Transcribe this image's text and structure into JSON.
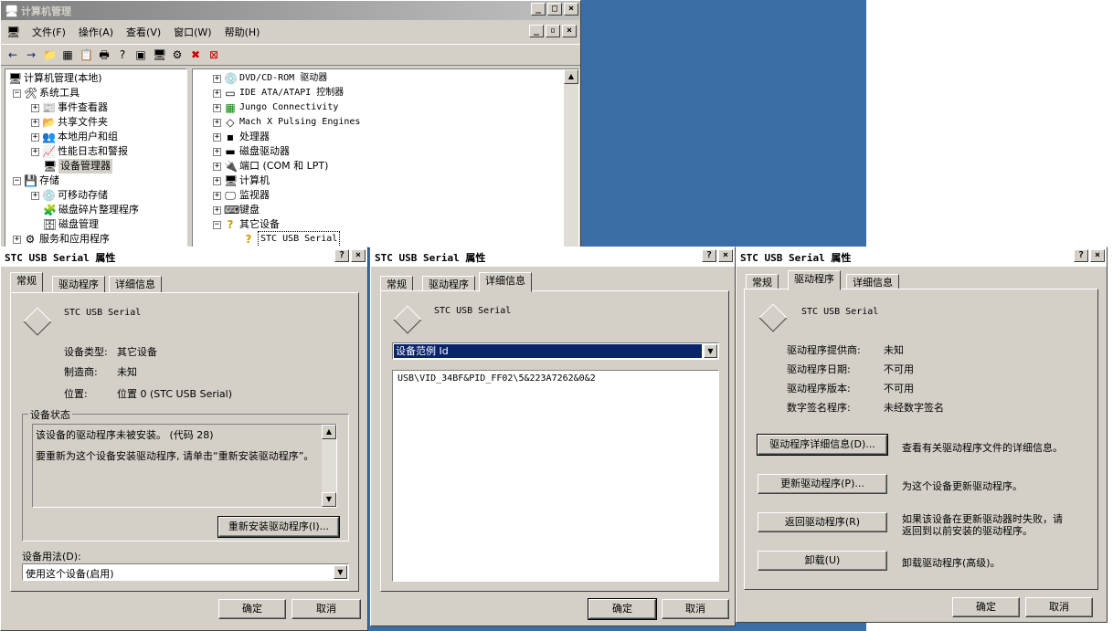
{
  "mmc": {
    "title": "计算机管理",
    "menu": [
      "文件(F)",
      "操作(A)",
      "查看(V)",
      "窗口(W)",
      "帮助(H)"
    ],
    "tree": {
      "root": "计算机管理(本地)",
      "system_tools": "系统工具",
      "event_viewer": "事件查看器",
      "shared_folders": "共享文件夹",
      "local_users": "本地用户和组",
      "perf_logs": "性能日志和警报",
      "device_manager": "设备管理器",
      "storage": "存储",
      "removable": "可移动存储",
      "defrag": "磁盘碎片整理程序",
      "disk_mgmt": "磁盘管理",
      "services": "服务和应用程序"
    },
    "devices": [
      "DVD/CD-ROM 驱动器",
      "IDE ATA/ATAPI 控制器",
      "Jungo Connectivity",
      "Mach  X Pulsing Engines",
      "处理器",
      "磁盘驱动器",
      "端口 (COM 和 LPT)",
      "计算机",
      "监视器",
      "键盘",
      "其它设备",
      "STC USB Serial"
    ]
  },
  "dlg1": {
    "title": "STC USB Serial 属性",
    "tabs": [
      "常规",
      "驱动程序",
      "详细信息"
    ],
    "device_name": "STC USB Serial",
    "type_label": "设备类型:",
    "type_value": "其它设备",
    "mfr_label": "制造商:",
    "mfr_value": "未知",
    "loc_label": "位置:",
    "loc_value": "位置 0 (STC USB Serial)",
    "status_title": "设备状态",
    "status_line1": "该设备的驱动程序未被安装。 (代码 28)",
    "status_line2": "要重新为这个设备安装驱动程序, 请单击“重新安装驱动程序”。",
    "reinstall_btn": "重新安装驱动程序(I)...",
    "usage_label": "设备用法(D):",
    "usage_value": "使用这个设备(启用)",
    "ok": "确定",
    "cancel": "取消"
  },
  "dlg2": {
    "title": "STC USB Serial 属性",
    "tabs": [
      "常规",
      "驱动程序",
      "详细信息"
    ],
    "device_name": "STC USB Serial",
    "combo_value": "设备范例 Id",
    "instance_id": "USB\\VID_34BF&PID_FF02\\5&223A7262&0&2",
    "ok": "确定",
    "cancel": "取消"
  },
  "dlg3": {
    "title": "STC USB Serial 属性",
    "tabs": [
      "常规",
      "驱动程序",
      "详细信息"
    ],
    "device_name": "STC USB Serial",
    "provider_label": "驱动程序提供商:",
    "provider_value": "未知",
    "date_label": "驱动程序日期:",
    "date_value": "不可用",
    "version_label": "驱动程序版本:",
    "version_value": "不可用",
    "signer_label": "数字签名程序:",
    "signer_value": "未经数字签名",
    "details_btn": "驱动程序详细信息(D)...",
    "details_desc": "查看有关驱动程序文件的详细信息。",
    "update_btn": "更新驱动程序(P)...",
    "update_desc": "为这个设备更新驱动程序。",
    "rollback_btn": "返回驱动程序(R)",
    "rollback_desc1": "如果该设备在更新驱动器时失败，请",
    "rollback_desc2": "返回到以前安装的驱动程序。",
    "uninstall_btn": "卸载(U)",
    "uninstall_desc": "卸载驱动程序(高级)。",
    "ok": "确定",
    "cancel": "取消"
  }
}
